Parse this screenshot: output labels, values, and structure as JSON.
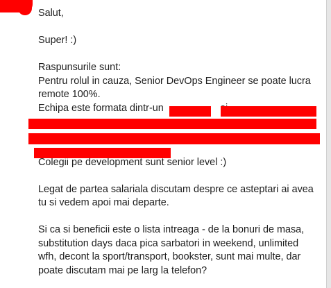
{
  "email": {
    "greeting": "Salut,",
    "reply": "Super! :)",
    "answers_heading": "Raspunsurile sunt:",
    "remote_line_1": "Pentru rolul in cauza, Senior DevOps Engineer se poate lucra",
    "remote_line_2": "remote 100%.",
    "team_line_start": "Echipa este formata dintr-un",
    "team_line_mid": "si",
    "colleagues": "Colegii pe development sunt senior level :)",
    "salary_line_1": "Legat de partea salariala discutam despre ce asteptari ai avea",
    "salary_line_2": "tu si vedem apoi mai departe.",
    "benefits_line_1": "Si ca si beneficii este o lista intreaga - de la bonuri de masa,",
    "benefits_line_2": "substitution days daca pica sarbatori in weekend, unlimited",
    "benefits_line_3": "wfh, decont la sport/transport, bookster, sunt mai multe, dar",
    "benefits_line_4": "poate discutam mai pe larg la telefon?"
  },
  "colors": {
    "redaction": "#ff0000",
    "text": "#1d1d1d",
    "background": "#ffffff"
  }
}
